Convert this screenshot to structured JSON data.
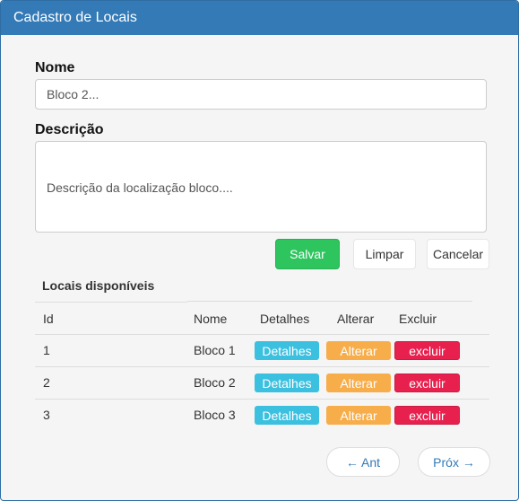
{
  "window": {
    "title": "Cadastro de Locais"
  },
  "form": {
    "name_label": "Nome",
    "name_value": "Bloco 2...",
    "description_label": "Descrição",
    "description_value": "Descrição da localização bloco...."
  },
  "actions": {
    "save": "Salvar",
    "clear": "Limpar",
    "cancel": "Cancelar"
  },
  "table": {
    "tab_title": "Locais disponíveis",
    "headers": {
      "id": "Id",
      "name": "Nome",
      "details": "Detalhes",
      "edit": "Alterar",
      "delete": "Excluir"
    },
    "rows": [
      {
        "id": "1",
        "name": "Bloco 1",
        "details": "Detalhes",
        "edit": "Alterar",
        "delete": "excluir"
      },
      {
        "id": "2",
        "name": "Bloco 2",
        "details": "Detalhes",
        "edit": "Alterar",
        "delete": "excluir"
      },
      {
        "id": "3",
        "name": "Bloco 3",
        "details": "Detalhes",
        "edit": "Alterar",
        "delete": "excluir"
      }
    ]
  },
  "pagination": {
    "prev": "← Ant",
    "next": "Próx →"
  },
  "colors": {
    "header": "#337ab7",
    "save": "#2ec55f",
    "details": "#3bc0e0",
    "edit": "#f7ad4a",
    "delete": "#e8204e"
  }
}
